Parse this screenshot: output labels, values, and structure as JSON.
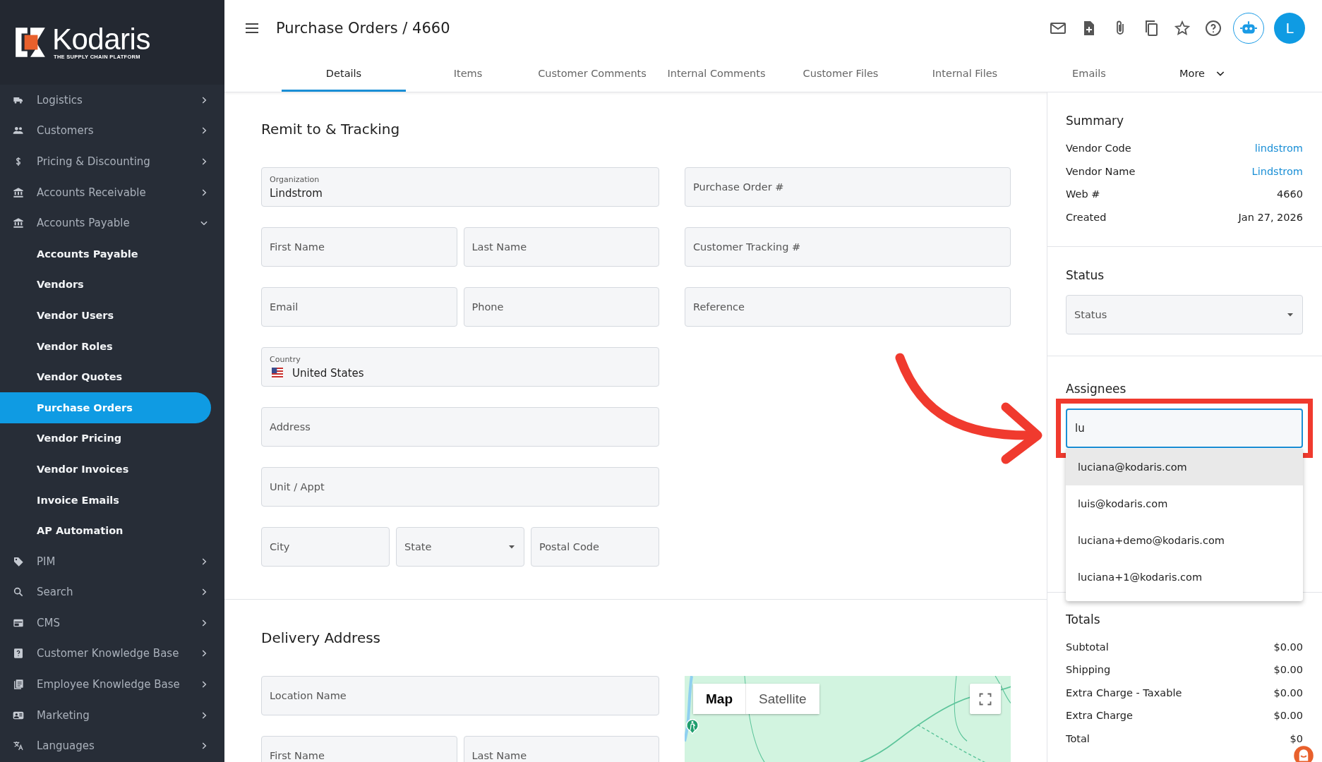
{
  "sidebar": {
    "brand": "Kodaris",
    "tagline": "THE SUPPLY CHAIN PLATFORM",
    "items": [
      {
        "label": "Logistics",
        "expanded": false
      },
      {
        "label": "Customers",
        "expanded": false
      },
      {
        "label": "Pricing & Discounting",
        "expanded": false
      },
      {
        "label": "Accounts Receivable",
        "expanded": false
      },
      {
        "label": "Accounts Payable",
        "expanded": true,
        "children": [
          {
            "label": "Accounts Payable",
            "selected": false
          },
          {
            "label": "Vendors",
            "selected": false
          },
          {
            "label": "Vendor Users",
            "selected": false
          },
          {
            "label": "Vendor Roles",
            "selected": false
          },
          {
            "label": "Vendor Quotes",
            "selected": false
          },
          {
            "label": "Purchase Orders",
            "selected": true
          },
          {
            "label": "Vendor Pricing",
            "selected": false
          },
          {
            "label": "Vendor Invoices",
            "selected": false
          },
          {
            "label": "Invoice Emails",
            "selected": false
          },
          {
            "label": "AP Automation",
            "selected": false
          }
        ]
      },
      {
        "label": "PIM",
        "expanded": false
      },
      {
        "label": "Search",
        "expanded": false
      },
      {
        "label": "CMS",
        "expanded": false
      },
      {
        "label": "Customer Knowledge Base",
        "expanded": false
      },
      {
        "label": "Employee Knowledge Base",
        "expanded": false
      },
      {
        "label": "Marketing",
        "expanded": false
      },
      {
        "label": "Languages",
        "expanded": false
      }
    ]
  },
  "header": {
    "title": "Purchase Orders / 4660",
    "avatar": "L"
  },
  "tabs": [
    {
      "label": "Details",
      "selected": true
    },
    {
      "label": "Items",
      "selected": false
    },
    {
      "label": "Customer Comments",
      "selected": false
    },
    {
      "label": "Internal Comments",
      "selected": false
    },
    {
      "label": "Customer Files",
      "selected": false
    },
    {
      "label": "Internal Files",
      "selected": false
    },
    {
      "label": "Emails",
      "selected": false
    },
    {
      "label": "More",
      "selected": false,
      "kind": "menu"
    }
  ],
  "remit": {
    "title": "Remit to & Tracking",
    "left_rows": [
      [
        {
          "kind": "text",
          "label": "Organization",
          "value": "Lindstrom"
        }
      ],
      [
        {
          "kind": "text",
          "placeholder": "First Name"
        },
        {
          "kind": "text",
          "placeholder": "Last Name"
        }
      ],
      [
        {
          "kind": "text",
          "placeholder": "Email"
        },
        {
          "kind": "text",
          "placeholder": "Phone"
        }
      ],
      [
        {
          "kind": "country",
          "label": "Country",
          "value": "United States"
        }
      ],
      [
        {
          "kind": "text",
          "placeholder": "Address"
        }
      ],
      [
        {
          "kind": "text",
          "placeholder": "Unit / Appt"
        }
      ],
      [
        {
          "kind": "text",
          "placeholder": "City"
        },
        {
          "kind": "select",
          "placeholder": "State"
        },
        {
          "kind": "text",
          "placeholder": "Postal Code"
        }
      ]
    ],
    "right_rows": [
      [
        {
          "kind": "text",
          "placeholder": "Purchase Order #"
        }
      ],
      [
        {
          "kind": "text",
          "placeholder": "Customer Tracking #"
        }
      ],
      [
        {
          "kind": "text",
          "placeholder": "Reference"
        }
      ]
    ]
  },
  "delivery": {
    "title": "Delivery Address",
    "rows": [
      [
        {
          "kind": "text",
          "placeholder": "Location Name"
        }
      ],
      [
        {
          "kind": "text",
          "placeholder": "First Name"
        },
        {
          "kind": "text",
          "placeholder": "Last Name"
        }
      ]
    ],
    "map": {
      "kind": "picture",
      "modes": [
        {
          "label": "Map",
          "selected": true
        },
        {
          "label": "Satellite",
          "selected": false
        }
      ]
    }
  },
  "summary": {
    "title": "Summary",
    "rows": [
      {
        "label": "Vendor Code",
        "value": "lindstrom",
        "kind": "link"
      },
      {
        "label": "Vendor Name",
        "value": "Lindstrom",
        "kind": "link"
      },
      {
        "label": "Web #",
        "value": "4660",
        "kind": "text"
      },
      {
        "label": "Created",
        "value": "Jan 27, 2026",
        "kind": "text"
      }
    ]
  },
  "status": {
    "title": "Status",
    "select": {
      "placeholder": "Status"
    }
  },
  "assignees": {
    "title": "Assignees",
    "input": {
      "value": "lu",
      "focused": true,
      "highlighted": true
    },
    "options": [
      {
        "label": "luciana@kodaris.com",
        "selected": true
      },
      {
        "label": "luis@kodaris.com",
        "selected": false
      },
      {
        "label": "luciana+demo@kodaris.com",
        "selected": false
      },
      {
        "label": "luciana+1@kodaris.com",
        "selected": false
      }
    ]
  },
  "totals": {
    "title": "Totals",
    "rows": [
      {
        "label": "Subtotal",
        "value": "$0.00"
      },
      {
        "label": "Shipping",
        "value": "$0.00"
      },
      {
        "label": "Extra Charge - Taxable",
        "value": "$0.00"
      },
      {
        "label": "Extra Charge",
        "value": "$0.00"
      },
      {
        "label": "Total",
        "value": "$0"
      }
    ]
  }
}
